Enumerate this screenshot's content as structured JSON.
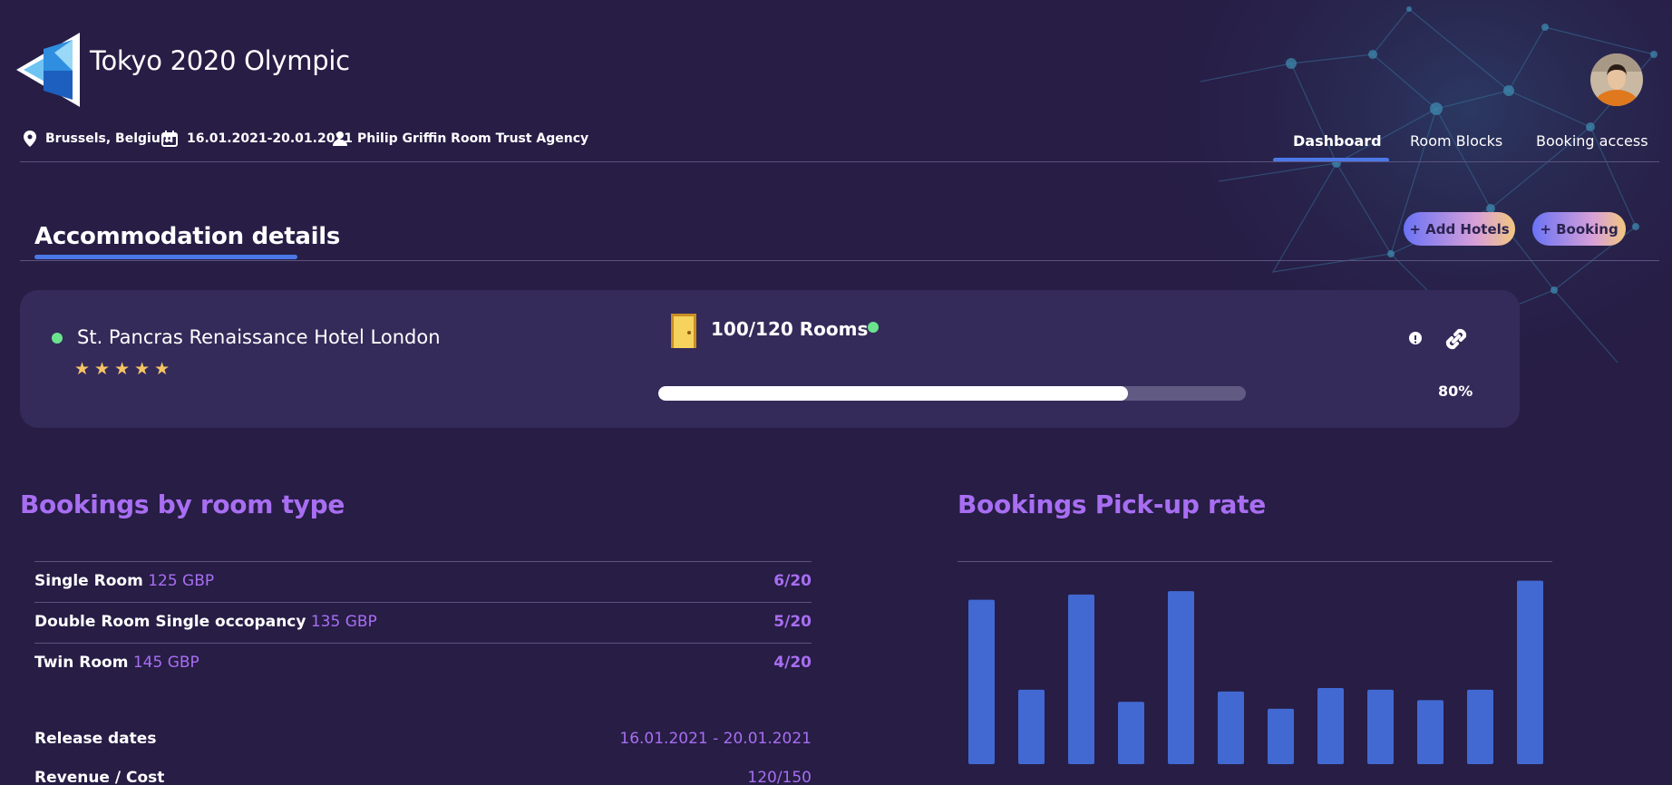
{
  "app": {
    "title": "Tokyo 2020 Olympic"
  },
  "event": {
    "location": "Brussels, Belgium",
    "dates": "16.01.2021-20.01.2021",
    "agency": "Philip Griffin Room Trust Agency"
  },
  "nav": {
    "tabs": [
      {
        "label": "Dashboard",
        "active": true
      },
      {
        "label": "Room Blocks",
        "active": false
      },
      {
        "label": "Booking access",
        "active": false
      }
    ]
  },
  "section": {
    "title": "Accommodation details",
    "add_hotels_label": "+ Add Hotels",
    "booking_label": "+ Booking"
  },
  "hotel": {
    "name": "St. Pancras Renaissance Hotel London",
    "stars": "★★★★★",
    "rating": 5,
    "rooms": "100/120 Rooms",
    "progress_percent": 80,
    "progress_label": "80%",
    "status_color": "#6be38d"
  },
  "room_types": {
    "title": "Bookings by room type",
    "rows": [
      {
        "name": "Single Room",
        "price": "125 GBP",
        "count": "6/20"
      },
      {
        "name": "Double Room Single occopancy",
        "price": "135 GBP",
        "count": "5/20"
      },
      {
        "name": "Twin Room",
        "price": "145 GBP",
        "count": "4/20"
      }
    ],
    "info": [
      {
        "label": "Release dates",
        "value": "16.01.2021 - 20.01.2021"
      },
      {
        "label": "Revenue / Cost",
        "value": "120/150"
      }
    ]
  },
  "pickup": {
    "title": "Bookings Pick-up rate"
  },
  "chart_data": {
    "type": "bar",
    "categories": [
      "",
      "",
      "",
      "",
      "",
      "",
      "",
      "",
      "",
      "",
      "",
      ""
    ],
    "values": [
      95,
      43,
      98,
      36,
      100,
      42,
      32,
      44,
      43,
      37,
      43,
      106
    ],
    "ylim": [
      0,
      110
    ],
    "grid": false,
    "color": "#4169d1"
  },
  "colors": {
    "accent": "#4b78e6",
    "purple": "#a86ef2",
    "background": "#271d45",
    "card": "#342b5a"
  }
}
